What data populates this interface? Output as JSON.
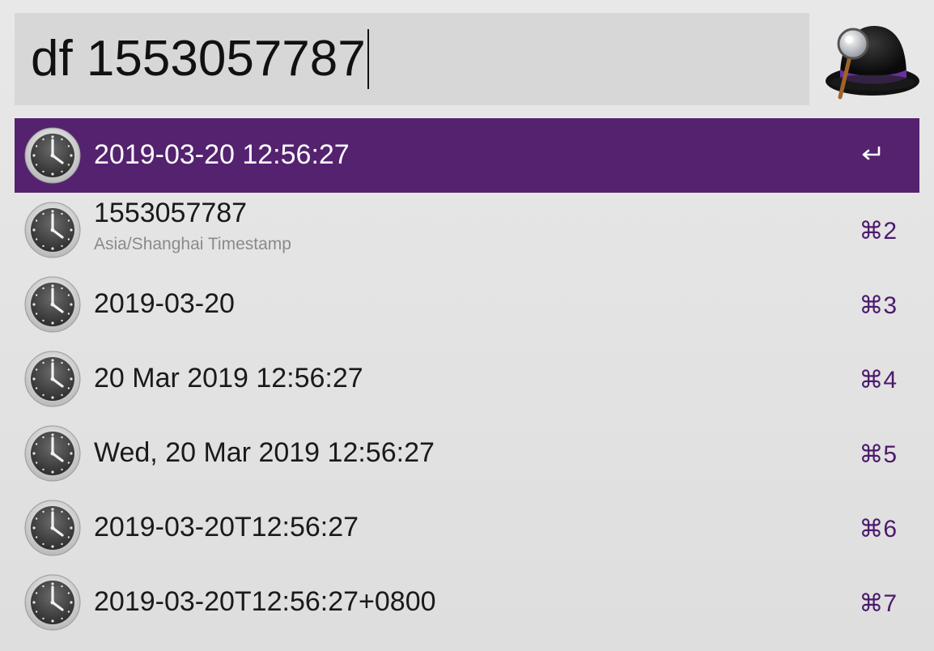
{
  "search": {
    "value": "df 1553057787"
  },
  "app": {
    "logo_icon": "alfred-hat-icon"
  },
  "colors": {
    "selected_bg": "#54226f",
    "shortcut": "#4b1a6c",
    "subtitle": "#8a8a8a"
  },
  "results": [
    {
      "title": "2019-03-20 12:56:27",
      "subtitle": "",
      "shortcut": "",
      "icon": "clock-icon",
      "action_icon": "enter-icon",
      "selected": true
    },
    {
      "title": "1553057787",
      "subtitle": "Asia/Shanghai Timestamp",
      "shortcut": "⌘2",
      "icon": "clock-icon"
    },
    {
      "title": "2019-03-20",
      "subtitle": "",
      "shortcut": "⌘3",
      "icon": "clock-icon"
    },
    {
      "title": "20 Mar 2019 12:56:27",
      "subtitle": "",
      "shortcut": "⌘4",
      "icon": "clock-icon"
    },
    {
      "title": "Wed, 20 Mar 2019 12:56:27",
      "subtitle": "",
      "shortcut": "⌘5",
      "icon": "clock-icon"
    },
    {
      "title": "2019-03-20T12:56:27",
      "subtitle": "",
      "shortcut": "⌘6",
      "icon": "clock-icon"
    },
    {
      "title": "2019-03-20T12:56:27+0800",
      "subtitle": "",
      "shortcut": "⌘7",
      "icon": "clock-icon"
    }
  ]
}
